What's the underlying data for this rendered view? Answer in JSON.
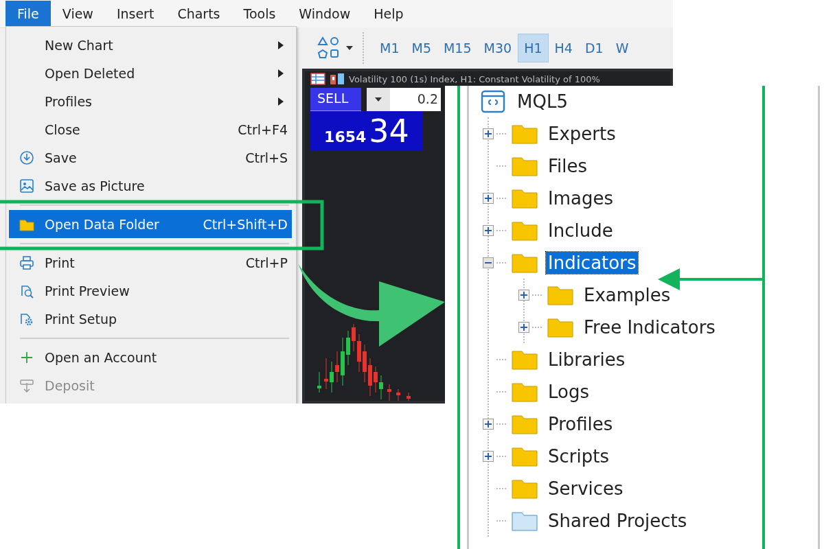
{
  "menu_bar": [
    {
      "label": "File",
      "selected": true
    },
    {
      "label": "View",
      "selected": false
    },
    {
      "label": "Insert",
      "selected": false
    },
    {
      "label": "Charts",
      "selected": false
    },
    {
      "label": "Tools",
      "selected": false
    },
    {
      "label": "Window",
      "selected": false
    },
    {
      "label": "Help",
      "selected": false
    }
  ],
  "file_menu": [
    {
      "kind": "item",
      "label": "New Chart",
      "submenu": true,
      "selected": false,
      "disabled": false
    },
    {
      "kind": "item",
      "label": "Open Deleted",
      "submenu": true,
      "selected": false,
      "disabled": false
    },
    {
      "kind": "item",
      "label": "Profiles",
      "submenu": true,
      "selected": false,
      "disabled": false
    },
    {
      "kind": "item",
      "label": "Close",
      "shortcut": "Ctrl+F4",
      "submenu": false,
      "selected": false,
      "disabled": false
    },
    {
      "kind": "item",
      "label": "Save",
      "shortcut": "Ctrl+S",
      "submenu": false,
      "selected": false,
      "disabled": false
    },
    {
      "kind": "item",
      "label": "Save as Picture",
      "submenu": false,
      "selected": false,
      "disabled": false
    },
    {
      "kind": "separator"
    },
    {
      "kind": "item",
      "label": "Open Data Folder",
      "shortcut": "Ctrl+Shift+D",
      "submenu": false,
      "selected": true,
      "disabled": false
    },
    {
      "kind": "separator"
    },
    {
      "kind": "item",
      "label": "Print",
      "shortcut": "Ctrl+P",
      "submenu": false,
      "selected": false,
      "disabled": false
    },
    {
      "kind": "item",
      "label": "Print Preview",
      "submenu": false,
      "selected": false,
      "disabled": false
    },
    {
      "kind": "item",
      "label": "Print Setup",
      "submenu": false,
      "selected": false,
      "disabled": false
    },
    {
      "kind": "separator"
    },
    {
      "kind": "item",
      "label": "Open an Account",
      "submenu": false,
      "selected": false,
      "disabled": false
    },
    {
      "kind": "item",
      "label": "Deposit",
      "submenu": false,
      "selected": false,
      "disabled": true
    }
  ],
  "timeframes": [
    {
      "label": "M1",
      "selected": false
    },
    {
      "label": "M5",
      "selected": false
    },
    {
      "label": "M15",
      "selected": false
    },
    {
      "label": "M30",
      "selected": false
    },
    {
      "label": "H1",
      "selected": true
    },
    {
      "label": "H4",
      "selected": false
    },
    {
      "label": "D1",
      "selected": false
    },
    {
      "label": "W",
      "selected": false
    }
  ],
  "chart": {
    "title": "Volatility 100 (1s) Index, H1: Constant Volatility of 100%",
    "sell_label": "SELL",
    "lot_value": "0.2",
    "price_small": "1654",
    "price_large": "34"
  },
  "tree": {
    "label": "MQL5",
    "children": [
      {
        "kind": "folder",
        "label": "Experts",
        "expandable": true,
        "expanded": false,
        "selected": false
      },
      {
        "kind": "folder",
        "label": "Files",
        "expandable": false,
        "selected": false
      },
      {
        "kind": "folder",
        "label": "Images",
        "expandable": true,
        "expanded": false,
        "selected": false
      },
      {
        "kind": "folder",
        "label": "Include",
        "expandable": true,
        "expanded": false,
        "selected": false
      },
      {
        "kind": "folder",
        "label": "Indicators",
        "expandable": true,
        "expanded": true,
        "selected": true,
        "children": [
          {
            "kind": "folder",
            "label": "Examples",
            "expandable": true,
            "expanded": false,
            "selected": false
          },
          {
            "kind": "folder",
            "label": "Free Indicators",
            "expandable": true,
            "expanded": false,
            "selected": false
          }
        ]
      },
      {
        "kind": "folder",
        "label": "Libraries",
        "expandable": false,
        "selected": false
      },
      {
        "kind": "folder",
        "label": "Logs",
        "expandable": false,
        "selected": false
      },
      {
        "kind": "folder",
        "label": "Profiles",
        "expandable": true,
        "expanded": false,
        "selected": false
      },
      {
        "kind": "folder",
        "label": "Scripts",
        "expandable": true,
        "expanded": false,
        "selected": false
      },
      {
        "kind": "folder",
        "label": "Services",
        "expandable": false,
        "selected": false
      },
      {
        "kind": "shared_folder",
        "label": "Shared Projects",
        "expandable": false,
        "selected": false
      }
    ]
  }
}
